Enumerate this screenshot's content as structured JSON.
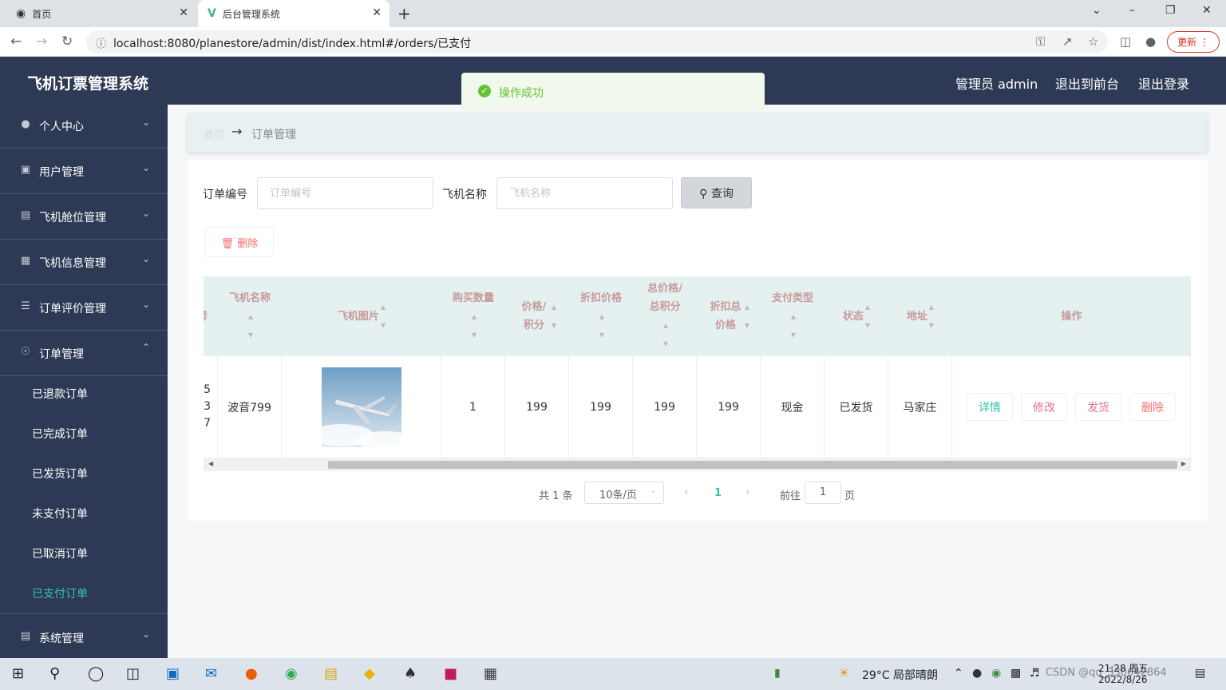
{
  "browser": {
    "tabs": [
      {
        "label": "首页"
      },
      {
        "label": "后台管理系统"
      }
    ],
    "url": "localhost:8080/planestore/admin/dist/index.html#/orders/已支付",
    "update_label": "更新"
  },
  "header": {
    "title": "飞机订票管理系统",
    "admin_label": "管理员 admin",
    "to_front": "退出到前台",
    "logout": "退出登录"
  },
  "toast": {
    "text": "操作成功"
  },
  "sidebar": {
    "menus": [
      {
        "label": "个人中心",
        "icon": "user-icon"
      },
      {
        "label": "用户管理",
        "icon": "briefcase-icon"
      },
      {
        "label": "飞机舱位管理",
        "icon": "truck-icon"
      },
      {
        "label": "飞机信息管理",
        "icon": "grid-icon"
      },
      {
        "label": "订单评价管理",
        "icon": "list-icon"
      },
      {
        "label": "订单管理",
        "icon": "mic-icon"
      },
      {
        "label": "系统管理",
        "icon": "clipboard-icon"
      }
    ],
    "submenus": [
      "已退款订单",
      "已完成订单",
      "已发货订单",
      "未支付订单",
      "已取消订单",
      "已支付订单"
    ],
    "active_color": "#35c6b0"
  },
  "breadcrumb": {
    "home": "首页",
    "current": "订单管理"
  },
  "search": {
    "order_no_label": "订单编号",
    "order_no_placeholder": "订单编号",
    "plane_name_label": "飞机名称",
    "plane_name_placeholder": "飞机名称",
    "query_label": "查询"
  },
  "delete_label": "删除",
  "table": {
    "headers": {
      "order_no": "号",
      "plane_name": "飞机名称",
      "image": "飞机图片",
      "qty": "购买数量",
      "price": "价格/积分",
      "disc_price": "折扣价格",
      "total": "总价格/总积分",
      "disc_total": "折扣总价格",
      "pay_type": "支付类型",
      "status": "状态",
      "address": "地址",
      "actions": "操作"
    },
    "row": {
      "order_no_fragments": [
        "5",
        "3",
        "7"
      ],
      "plane_name": "波音799",
      "qty": "1",
      "price": "199",
      "disc_price": "199",
      "total": "199",
      "disc_total": "199",
      "pay_type": "现金",
      "status": "已发货",
      "address": "马家庄"
    },
    "actions": {
      "detail": "详情",
      "edit": "修改",
      "ship": "发货",
      "delete": "删除"
    },
    "action_colors": {
      "detail": "#35c6b0",
      "edit": "#e0719a",
      "ship": "#e0719a",
      "delete": "#f56c6c"
    }
  },
  "pagination": {
    "total_text": "共 1 条",
    "page_size": "10条/页",
    "current_page": "1",
    "goto_label": "前往",
    "goto_value": "1",
    "page_suffix": "页"
  },
  "taskbar": {
    "weather": "29°C  局部晴朗",
    "time": "21:28 周五",
    "date": "2022/8/26",
    "watermark": "CSDN @qq_330642864"
  }
}
